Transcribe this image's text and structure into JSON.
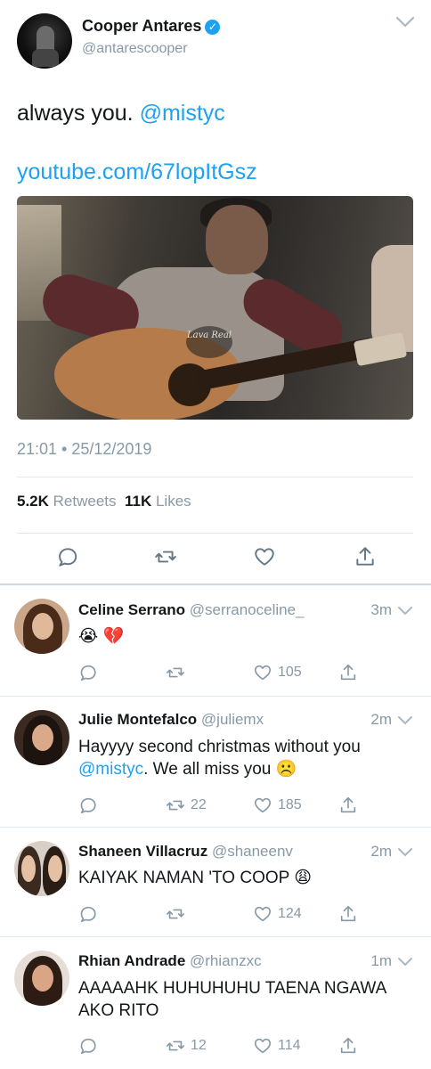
{
  "tweet": {
    "name": "Cooper Antares",
    "verified_mark": "✓",
    "handle": "@antarescooper",
    "text": "always you.",
    "mention": "@mistyc",
    "link": "youtube.com/67lopItGsz",
    "timestamp": "21:01 • 25/12/2019",
    "retweets_count": "5.2K",
    "retweets_label": "Retweets",
    "likes_count": "11K",
    "likes_label": "Likes",
    "media_logo": "Lava Real",
    "media_watermark": "",
    "icons": [
      "reply-icon",
      "retweet-icon",
      "like-icon",
      "share-icon"
    ]
  },
  "replies": [
    {
      "name": "Celine Serrano",
      "handle": "@serranoceline_",
      "time": "3m",
      "text": "😭 💔",
      "mention": "",
      "text_after": "",
      "retweets": "",
      "likes": "105"
    },
    {
      "name": "Julie Montefalco",
      "handle": "@juliemx",
      "time": "2m",
      "text": "Hayyyy second christmas without you ",
      "mention": "@mistyc",
      "text_after": ". We all miss you ☹️",
      "retweets": "22",
      "likes": "185"
    },
    {
      "name": "Shaneen Villacruz",
      "handle": "@shaneenv",
      "time": "2m",
      "text": "KAIYAK NAMAN 'TO COOP 😩",
      "mention": "",
      "text_after": "",
      "retweets": "",
      "likes": "124"
    },
    {
      "name": "Rhian Andrade",
      "handle": "@rhianzxc",
      "time": "1m",
      "text": "AAAAAHK HUHUHUHU TAENA NGAWA AKO RITO",
      "mention": "",
      "text_after": "",
      "retweets": "12",
      "likes": "114"
    }
  ],
  "colors": {
    "accent": "#1da1f2",
    "muted": "#8899a6",
    "text": "#14171a",
    "border": "#e1e8ed"
  }
}
